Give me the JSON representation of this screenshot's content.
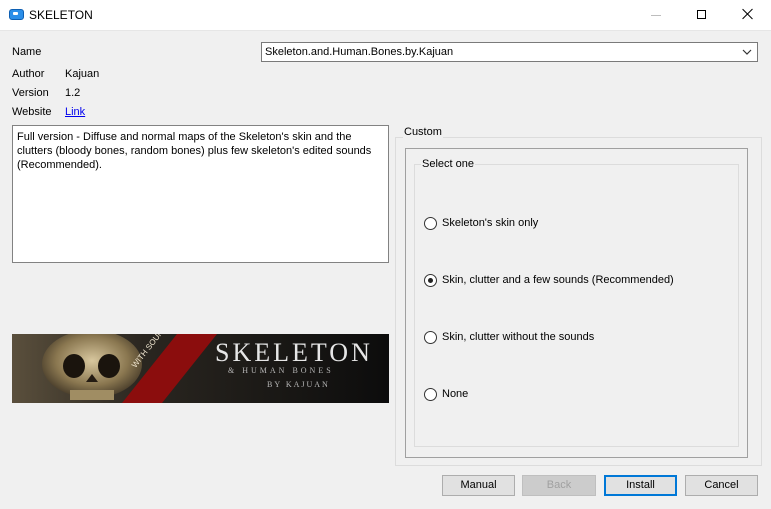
{
  "window": {
    "title": "SKELETON",
    "icon": "app-icon",
    "controls": {
      "minimize": "minimize-icon",
      "maximize": "maximize-icon",
      "close": "close-icon"
    }
  },
  "info": {
    "name_label": "Name",
    "author_label": "Author",
    "author_value": "Kajuan",
    "version_label": "Version",
    "version_value": "1.2",
    "website_label": "Website",
    "website_link": "Link"
  },
  "package_select": {
    "value": "Skeleton.and.Human.Bones.by.Kajuan"
  },
  "description": "Full version - Diffuse and normal maps of the Skeleton's skin and the clutters (bloody bones, random bones) plus few skeleton's edited sounds (Recommended).",
  "banner": {
    "title": "SKELETON",
    "subtitle": "& HUMAN BONES",
    "byline": "BY KAJUAN",
    "ribbon": "WITH SOUNDS"
  },
  "custom": {
    "legend": "Custom",
    "group_legend": "Select one",
    "options": [
      {
        "label": "Skeleton's skin only",
        "selected": false
      },
      {
        "label": "Skin, clutter and a few sounds (Recommended)",
        "selected": true
      },
      {
        "label": "Skin, clutter without the sounds",
        "selected": false
      },
      {
        "label": "None",
        "selected": false
      }
    ]
  },
  "buttons": {
    "manual": "Manual",
    "back": "Back",
    "install": "Install",
    "cancel": "Cancel"
  },
  "colors": {
    "accent": "#0078d7",
    "link": "#0000ee",
    "window_bg": "#f0f0f0"
  }
}
